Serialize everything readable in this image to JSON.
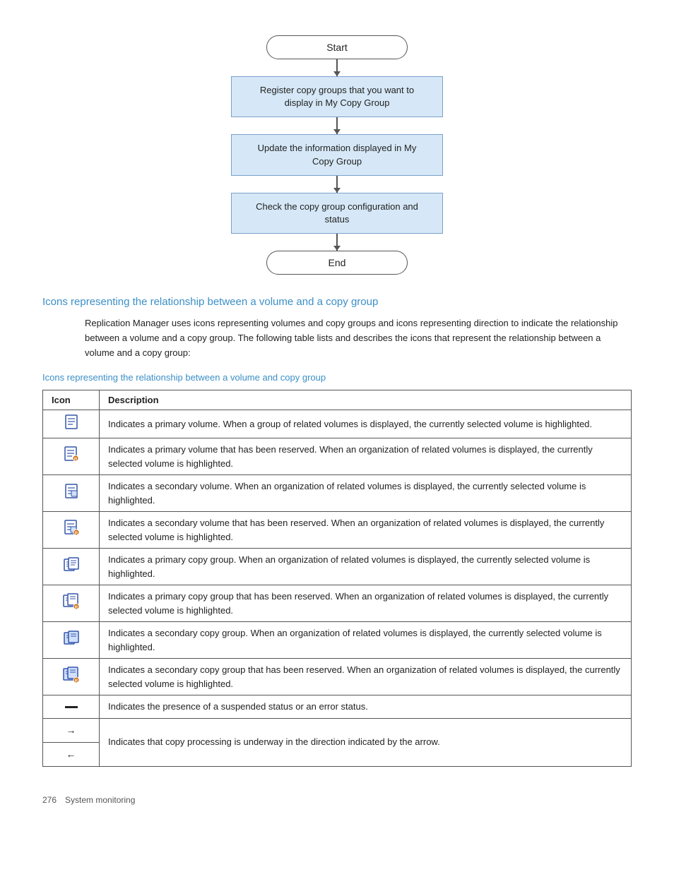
{
  "flowchart": {
    "start_label": "Start",
    "end_label": "End",
    "box1": "Register copy groups that you want to display in My Copy Group",
    "box2": "Update the information displayed in My Copy Group",
    "box3": "Check the copy group configuration and status"
  },
  "section_heading": "Icons representing the relationship between a volume and a copy group",
  "body_text": "Replication Manager uses icons representing volumes and copy groups and icons representing direction to indicate the relationship between a volume and a copy group. The following table lists and describes the icons that represent the relationship between a volume and a copy group:",
  "sub_heading": "Icons representing the relationship between a volume and copy group",
  "table": {
    "col1": "Icon",
    "col2": "Description",
    "rows": [
      {
        "icon_type": "primary_volume",
        "description": "Indicates a primary volume. When a group of related volumes is displayed, the currently selected volume is highlighted."
      },
      {
        "icon_type": "primary_volume_reserved",
        "description": "Indicates a primary volume that has been reserved. When an organization of related volumes is displayed, the currently selected volume is highlighted."
      },
      {
        "icon_type": "secondary_volume",
        "description": "Indicates a secondary volume. When an organization of related volumes is displayed, the currently selected volume is highlighted."
      },
      {
        "icon_type": "secondary_volume_reserved",
        "description": "Indicates a secondary volume that has been reserved. When an organization of related volumes is displayed, the currently selected volume is highlighted."
      },
      {
        "icon_type": "primary_copy_group",
        "description": "Indicates a primary copy group. When an organization of related volumes is displayed, the currently selected volume is highlighted."
      },
      {
        "icon_type": "primary_copy_group_reserved",
        "description": "Indicates a primary copy group that has been reserved. When an organization of related volumes is displayed, the currently selected volume is highlighted."
      },
      {
        "icon_type": "secondary_copy_group",
        "description": "Indicates a secondary copy group. When an organization of related volumes is displayed, the currently selected volume is highlighted."
      },
      {
        "icon_type": "secondary_copy_group_reserved",
        "description": "Indicates a secondary copy group that has been reserved. When an organization of related volumes is displayed, the currently selected volume is highlighted."
      },
      {
        "icon_type": "dash",
        "description": "Indicates the presence of a suspended status or an error status."
      },
      {
        "icon_type": "arrow_right",
        "description": "Indicates that copy processing is underway in the direction indicated by the arrow."
      },
      {
        "icon_type": "arrow_left",
        "description": ""
      }
    ]
  },
  "footer": {
    "page_number": "276",
    "page_label": "System monitoring"
  }
}
